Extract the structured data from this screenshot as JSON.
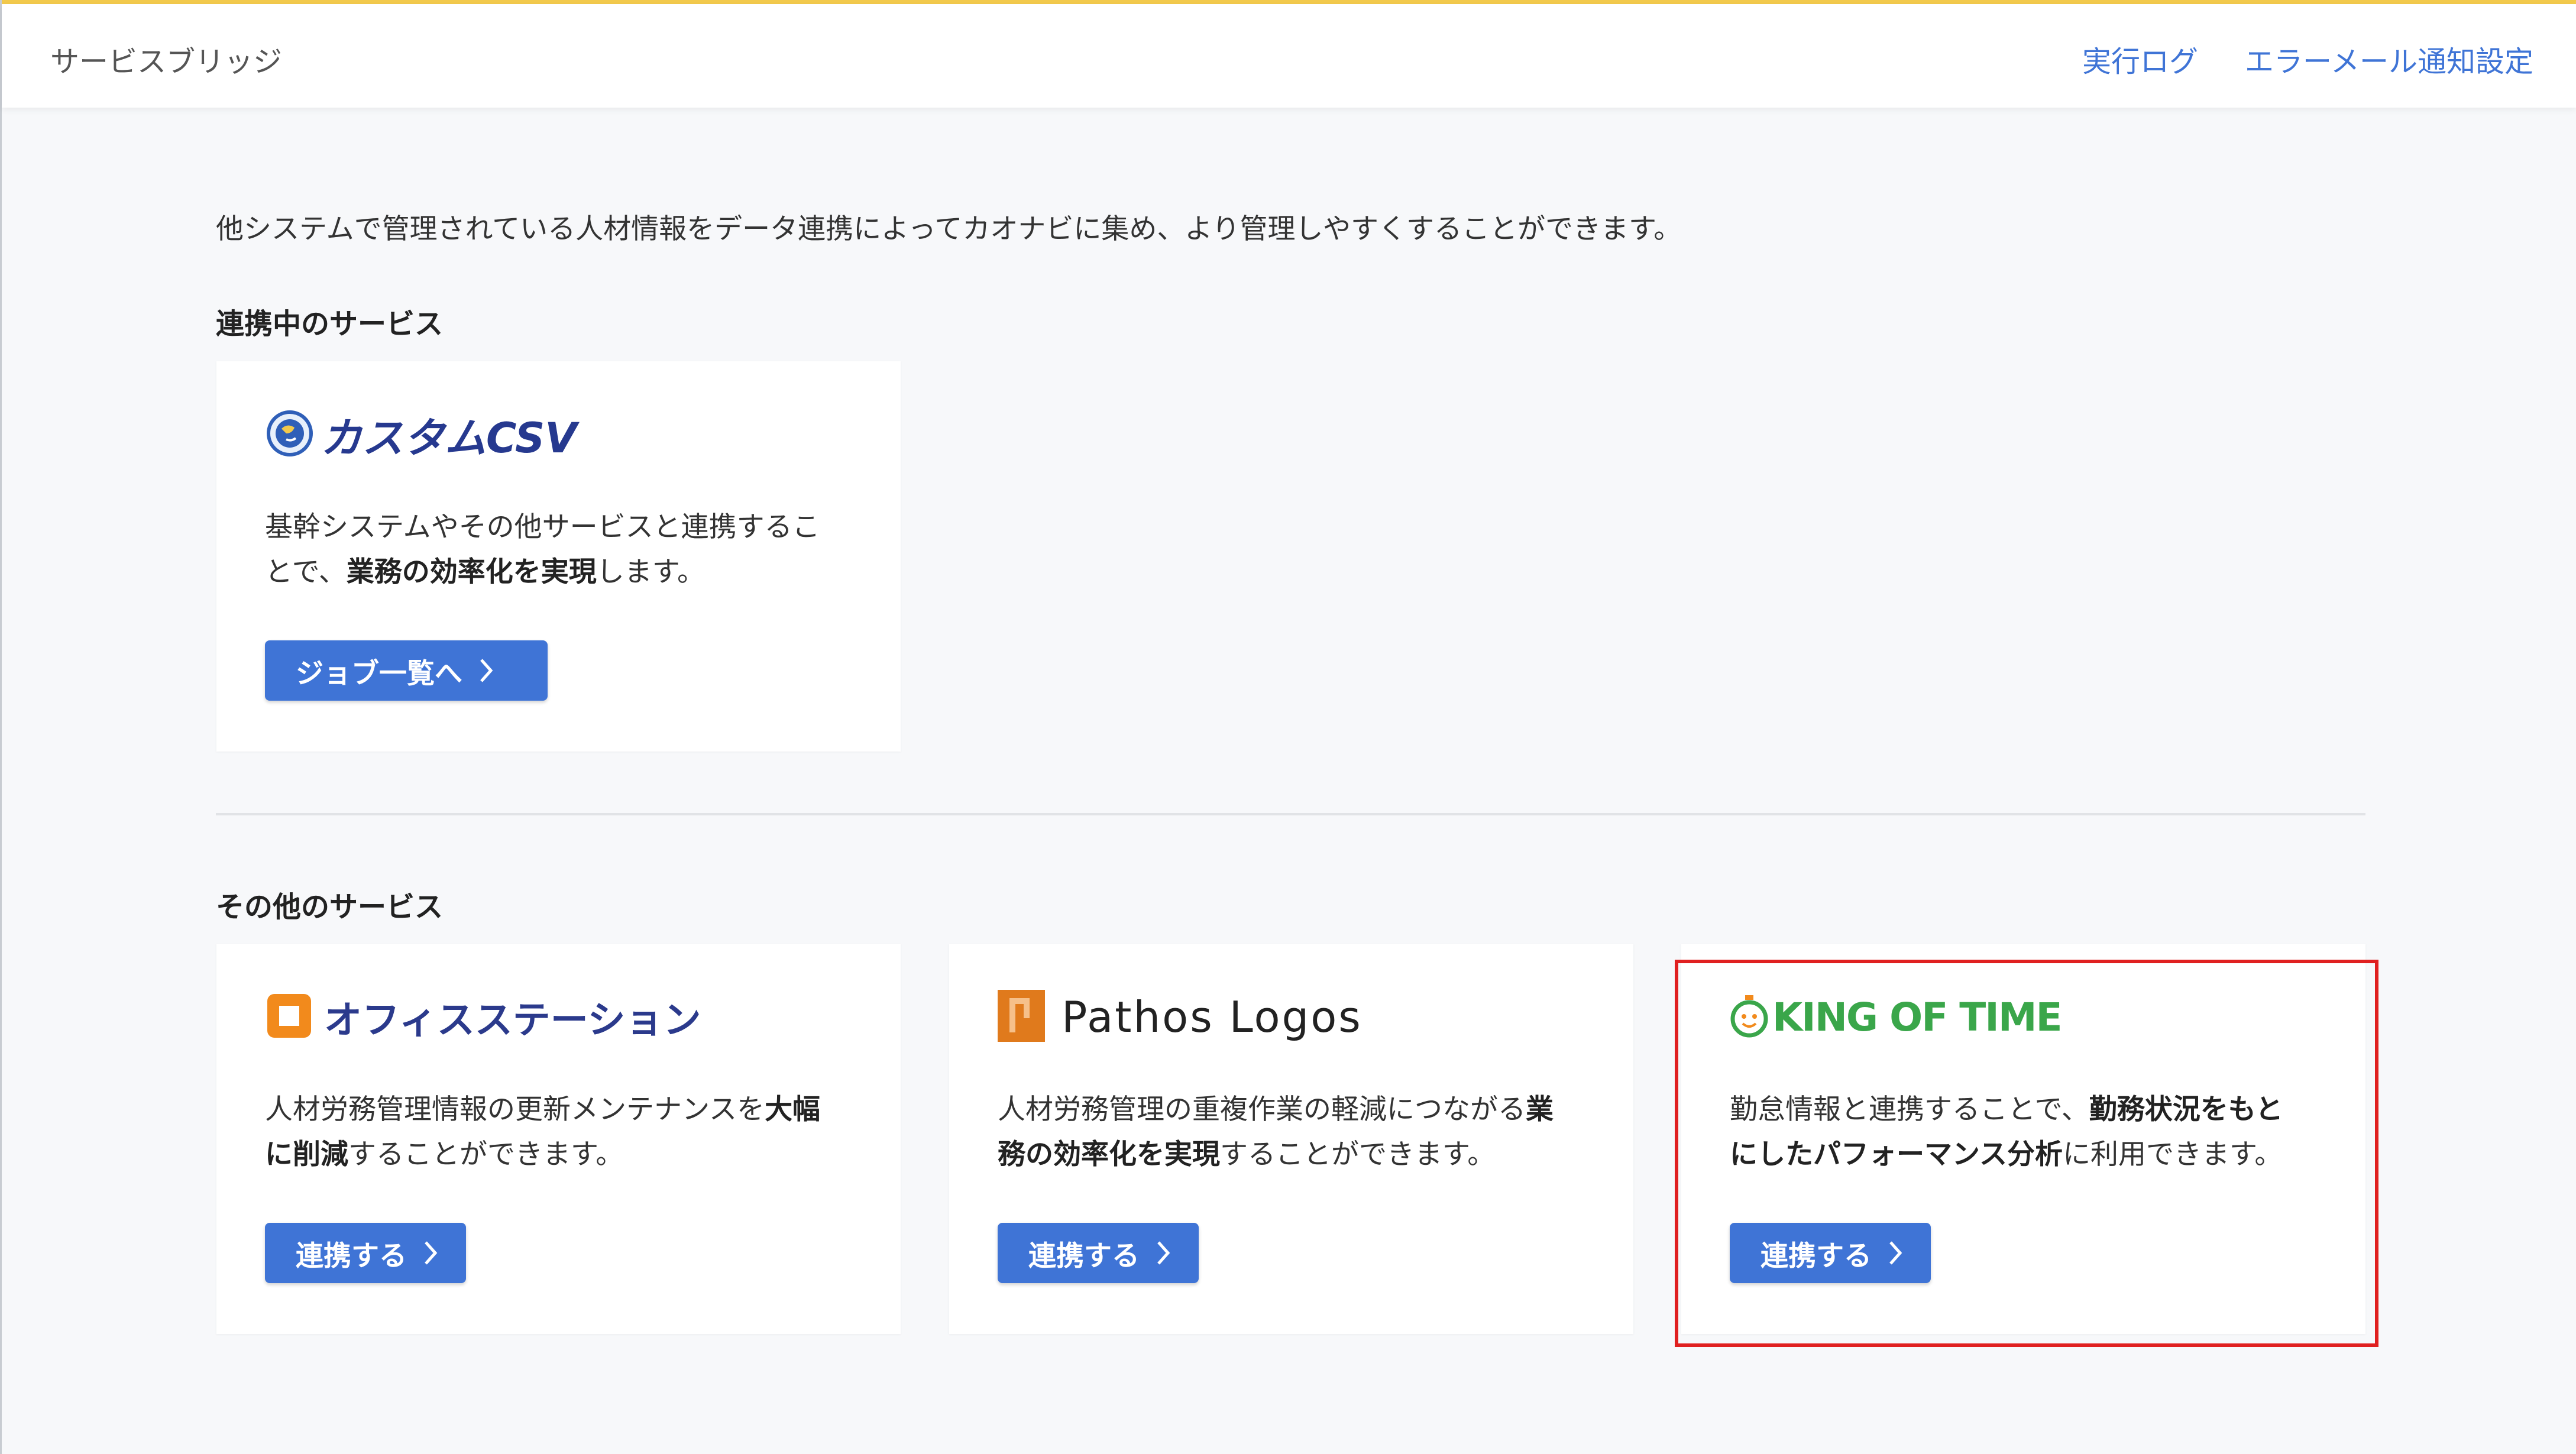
{
  "header": {
    "app_title": "サービスブリッジ",
    "links": {
      "exec_log": "実行ログ",
      "error_mail": "エラーメール通知設定"
    }
  },
  "intro": "他システムで管理されている人材情報をデータ連携によってカオナビに集め、より管理しやすくすることができます。",
  "active_services": {
    "title": "連携中のサービス",
    "cards": [
      {
        "logo_icon": "globe-icon",
        "logo_text": "カスタムCSV",
        "desc_parts": [
          "基幹システムやその他サービスと連携するこ",
          "とで、",
          "業務の効率化を実現",
          "します。"
        ],
        "button_label": "ジョブ一覧へ"
      }
    ]
  },
  "other_services": {
    "title": "その他のサービス",
    "cards": [
      {
        "logo_icon": "orange-square-icon",
        "logo_text": "オフィスステーション",
        "desc_parts": [
          "人材労務管理情報の更新メンテナンスを",
          "大幅",
          "に削減",
          "することができます。"
        ],
        "button_label": "連携する"
      },
      {
        "logo_icon": "pathos-logos-icon",
        "logo_text": "Pathos Logos",
        "desc_parts": [
          "人材労務管理の重複作業の軽減につながる",
          "業",
          "務の効率化を実現",
          "することができます。"
        ],
        "button_label": "連携する"
      },
      {
        "logo_icon": "stopwatch-face-icon",
        "logo_text": "KING OF TIME",
        "desc_parts": [
          "勤怠情報と連携することで、",
          "勤務状況をもと",
          "にしたパフォーマンス分析",
          "に利用できます。"
        ],
        "button_label": "連携する"
      }
    ]
  },
  "colors": {
    "accent": "#3f74d6",
    "highlight": "#e02020",
    "top_bar": "#f2c94c",
    "kot_green": "#3aa64a"
  }
}
